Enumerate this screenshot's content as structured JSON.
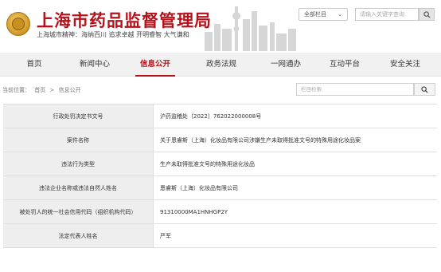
{
  "header": {
    "title": "上海市药品监督管理局",
    "slogan": "上海城市精神：海纳百川  追求卓越  开明睿智  大气谦和",
    "channel_select": "全部栏目",
    "search_placeholder": "请输入关键字查询",
    "brand_color": "#b5121b"
  },
  "nav": {
    "items": [
      {
        "label": "首页",
        "active": false
      },
      {
        "label": "新闻中心",
        "active": false
      },
      {
        "label": "信息公开",
        "active": true
      },
      {
        "label": "政务法规",
        "active": false
      },
      {
        "label": "一网通办",
        "active": false
      },
      {
        "label": "互动平台",
        "active": false
      },
      {
        "label": "安全关注",
        "active": false
      }
    ]
  },
  "breadcrumb": {
    "prefix": "当前位置：",
    "items": [
      "首页",
      ">",
      "信息公开"
    ]
  },
  "column_search": {
    "placeholder": "栏目检索"
  },
  "record": {
    "rows": [
      {
        "label": "行政处罚决定书文号",
        "value": "沪药监稽处〔2022〕762022000008号"
      },
      {
        "label": "案件名称",
        "value": "关于恩睿斯（上海）化妆品有限公司涉嫌生产未取得批准文号的特殊用途化妆品案"
      },
      {
        "label": "违法行为类型",
        "value": "生产未取得批准文号的特殊用途化妆品"
      },
      {
        "label": "违法企业名称或违法自然人姓名",
        "value": "恩睿斯（上海）化妆品有限公司"
      },
      {
        "label": "被处罚人的统一社会信用代码（组织机构代码）",
        "value": "91310000MA1HNHGP2Y"
      },
      {
        "label": "法定代表人姓名",
        "value": "严军"
      }
    ]
  }
}
